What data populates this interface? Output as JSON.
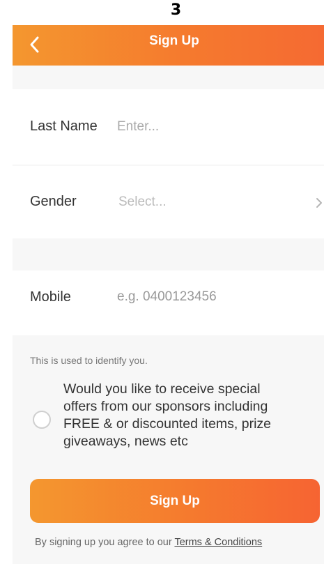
{
  "step": {
    "number": "3"
  },
  "header": {
    "back_icon": "chevron-left-icon",
    "title": "Sign Up"
  },
  "form": {
    "last_name": {
      "label": "Last Name",
      "placeholder": "Enter..."
    },
    "gender": {
      "label": "Gender",
      "placeholder": "Select...",
      "icon": "chevron-right-icon"
    },
    "mobile": {
      "label": "Mobile",
      "placeholder": "e.g. 0400123456"
    },
    "helper_text": "This is used to identify you.",
    "opt_in": {
      "checked": false,
      "lines": [
        "Would you like to receive special",
        "offers from our sponsors including",
        "FREE & or discounted items, prize",
        "giveaways, news etc"
      ]
    }
  },
  "actions": {
    "signup_label": "Sign Up"
  },
  "footer": {
    "terms_prefix": "By signing up you agree to our ",
    "terms_link": "Terms & Conditions"
  },
  "colors": {
    "accent_start": "#f4972f",
    "accent_end": "#f56a32",
    "background": "#f7f7f7"
  }
}
